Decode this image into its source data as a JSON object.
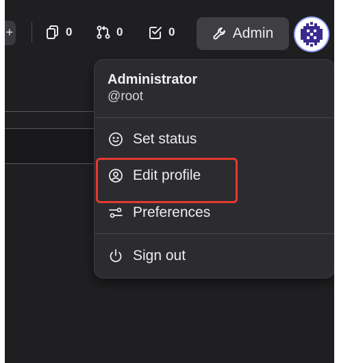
{
  "header": {
    "partial_button_glyph": "+",
    "counters": [
      {
        "icon": "issues-icon",
        "value": "0"
      },
      {
        "icon": "merge-requests-icon",
        "value": "0"
      },
      {
        "icon": "todos-icon",
        "value": "0"
      }
    ],
    "admin_label": "Admin",
    "admin_icon": "wrench-icon",
    "avatar_icon": "identicon-avatar"
  },
  "user_menu": {
    "name": "Administrator",
    "handle": "@root",
    "items": [
      {
        "label": "Set status",
        "icon": "smiley-icon"
      },
      {
        "label": "Edit profile",
        "icon": "user-circle-icon"
      },
      {
        "label": "Preferences",
        "icon": "sliders-icon"
      },
      {
        "label": "Sign out",
        "icon": "power-icon"
      }
    ]
  },
  "colors": {
    "background": "#1f1f21",
    "menu_bg": "#2c2c30",
    "highlight_border": "#e53a2e",
    "avatar_accent": "#3b2a8f"
  }
}
